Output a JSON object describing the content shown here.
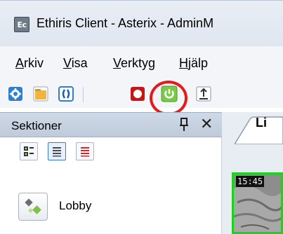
{
  "window": {
    "title": "Ethiris Client - Asterix - AdminM",
    "app_icon_text": "Ec"
  },
  "menubar": {
    "items": [
      {
        "label": "Arkiv",
        "mnemonic": "A"
      },
      {
        "label": "Visa",
        "mnemonic": "V"
      },
      {
        "label": "Verktyg",
        "mnemonic": "V"
      },
      {
        "label": "Hjälp",
        "mnemonic": "H"
      }
    ]
  },
  "toolbar": {
    "buttons": [
      {
        "name": "settings-icon"
      },
      {
        "name": "folder-icon"
      },
      {
        "name": "brackets-icon"
      },
      {
        "name": "record-icon"
      },
      {
        "name": "power-icon",
        "highlighted": true
      },
      {
        "name": "export-icon"
      }
    ],
    "accent": "#e41b1b"
  },
  "sections_panel": {
    "title": "Sektioner",
    "pin_icon": "pin-icon",
    "close_icon": "close-icon",
    "view_buttons": [
      {
        "name": "grid-view-icon",
        "active": false
      },
      {
        "name": "list-view-icon",
        "active": true
      },
      {
        "name": "red-list-view-icon",
        "active": false
      }
    ],
    "items": [
      {
        "label": "Lobby",
        "icon": "lobby-icon"
      }
    ]
  },
  "video_area": {
    "tab_label": "Li",
    "timestamp": "15:45",
    "border_color": "#1fd11f"
  }
}
